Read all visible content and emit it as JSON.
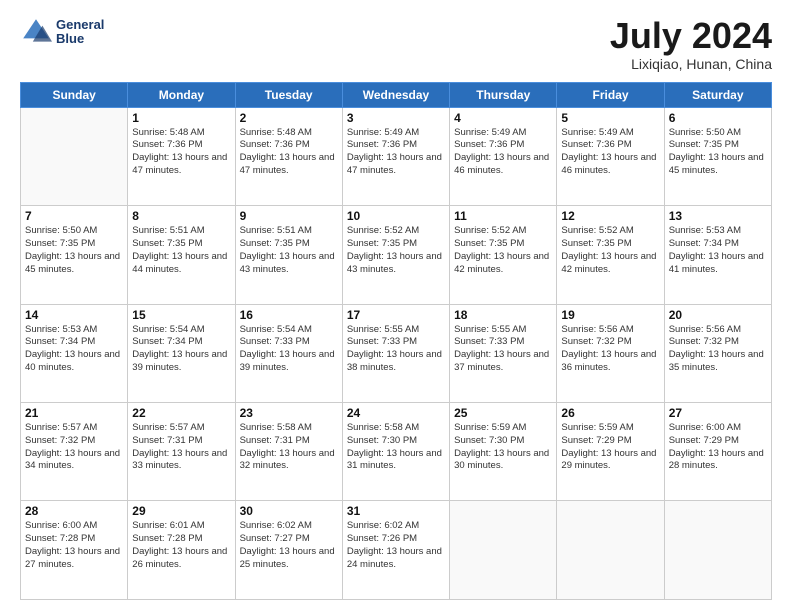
{
  "logo": {
    "line1": "General",
    "line2": "Blue"
  },
  "header": {
    "month": "July 2024",
    "location": "Lixiqiao, Hunan, China"
  },
  "weekdays": [
    "Sunday",
    "Monday",
    "Tuesday",
    "Wednesday",
    "Thursday",
    "Friday",
    "Saturday"
  ],
  "weeks": [
    [
      {
        "day": "",
        "info": ""
      },
      {
        "day": "1",
        "info": "Sunrise: 5:48 AM\nSunset: 7:36 PM\nDaylight: 13 hours and 47 minutes."
      },
      {
        "day": "2",
        "info": "Sunrise: 5:48 AM\nSunset: 7:36 PM\nDaylight: 13 hours and 47 minutes."
      },
      {
        "day": "3",
        "info": "Sunrise: 5:49 AM\nSunset: 7:36 PM\nDaylight: 13 hours and 47 minutes."
      },
      {
        "day": "4",
        "info": "Sunrise: 5:49 AM\nSunset: 7:36 PM\nDaylight: 13 hours and 46 minutes."
      },
      {
        "day": "5",
        "info": "Sunrise: 5:49 AM\nSunset: 7:36 PM\nDaylight: 13 hours and 46 minutes."
      },
      {
        "day": "6",
        "info": "Sunrise: 5:50 AM\nSunset: 7:35 PM\nDaylight: 13 hours and 45 minutes."
      }
    ],
    [
      {
        "day": "7",
        "info": "Sunrise: 5:50 AM\nSunset: 7:35 PM\nDaylight: 13 hours and 45 minutes."
      },
      {
        "day": "8",
        "info": "Sunrise: 5:51 AM\nSunset: 7:35 PM\nDaylight: 13 hours and 44 minutes."
      },
      {
        "day": "9",
        "info": "Sunrise: 5:51 AM\nSunset: 7:35 PM\nDaylight: 13 hours and 43 minutes."
      },
      {
        "day": "10",
        "info": "Sunrise: 5:52 AM\nSunset: 7:35 PM\nDaylight: 13 hours and 43 minutes."
      },
      {
        "day": "11",
        "info": "Sunrise: 5:52 AM\nSunset: 7:35 PM\nDaylight: 13 hours and 42 minutes."
      },
      {
        "day": "12",
        "info": "Sunrise: 5:52 AM\nSunset: 7:35 PM\nDaylight: 13 hours and 42 minutes."
      },
      {
        "day": "13",
        "info": "Sunrise: 5:53 AM\nSunset: 7:34 PM\nDaylight: 13 hours and 41 minutes."
      }
    ],
    [
      {
        "day": "14",
        "info": "Sunrise: 5:53 AM\nSunset: 7:34 PM\nDaylight: 13 hours and 40 minutes."
      },
      {
        "day": "15",
        "info": "Sunrise: 5:54 AM\nSunset: 7:34 PM\nDaylight: 13 hours and 39 minutes."
      },
      {
        "day": "16",
        "info": "Sunrise: 5:54 AM\nSunset: 7:33 PM\nDaylight: 13 hours and 39 minutes."
      },
      {
        "day": "17",
        "info": "Sunrise: 5:55 AM\nSunset: 7:33 PM\nDaylight: 13 hours and 38 minutes."
      },
      {
        "day": "18",
        "info": "Sunrise: 5:55 AM\nSunset: 7:33 PM\nDaylight: 13 hours and 37 minutes."
      },
      {
        "day": "19",
        "info": "Sunrise: 5:56 AM\nSunset: 7:32 PM\nDaylight: 13 hours and 36 minutes."
      },
      {
        "day": "20",
        "info": "Sunrise: 5:56 AM\nSunset: 7:32 PM\nDaylight: 13 hours and 35 minutes."
      }
    ],
    [
      {
        "day": "21",
        "info": "Sunrise: 5:57 AM\nSunset: 7:32 PM\nDaylight: 13 hours and 34 minutes."
      },
      {
        "day": "22",
        "info": "Sunrise: 5:57 AM\nSunset: 7:31 PM\nDaylight: 13 hours and 33 minutes."
      },
      {
        "day": "23",
        "info": "Sunrise: 5:58 AM\nSunset: 7:31 PM\nDaylight: 13 hours and 32 minutes."
      },
      {
        "day": "24",
        "info": "Sunrise: 5:58 AM\nSunset: 7:30 PM\nDaylight: 13 hours and 31 minutes."
      },
      {
        "day": "25",
        "info": "Sunrise: 5:59 AM\nSunset: 7:30 PM\nDaylight: 13 hours and 30 minutes."
      },
      {
        "day": "26",
        "info": "Sunrise: 5:59 AM\nSunset: 7:29 PM\nDaylight: 13 hours and 29 minutes."
      },
      {
        "day": "27",
        "info": "Sunrise: 6:00 AM\nSunset: 7:29 PM\nDaylight: 13 hours and 28 minutes."
      }
    ],
    [
      {
        "day": "28",
        "info": "Sunrise: 6:00 AM\nSunset: 7:28 PM\nDaylight: 13 hours and 27 minutes."
      },
      {
        "day": "29",
        "info": "Sunrise: 6:01 AM\nSunset: 7:28 PM\nDaylight: 13 hours and 26 minutes."
      },
      {
        "day": "30",
        "info": "Sunrise: 6:02 AM\nSunset: 7:27 PM\nDaylight: 13 hours and 25 minutes."
      },
      {
        "day": "31",
        "info": "Sunrise: 6:02 AM\nSunset: 7:26 PM\nDaylight: 13 hours and 24 minutes."
      },
      {
        "day": "",
        "info": ""
      },
      {
        "day": "",
        "info": ""
      },
      {
        "day": "",
        "info": ""
      }
    ]
  ]
}
